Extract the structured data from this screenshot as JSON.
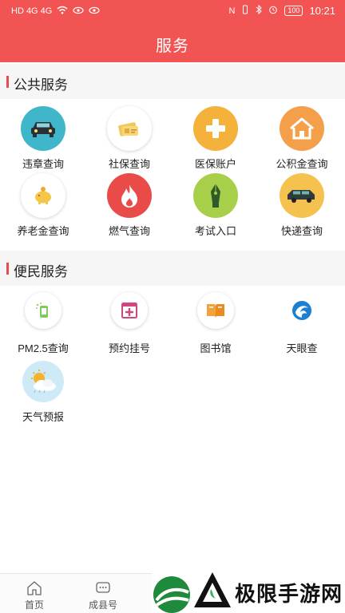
{
  "status_bar": {
    "left_text": "HD 4G 4G",
    "nfc": "N",
    "battery": "100",
    "time": "10:21"
  },
  "header": {
    "title": "服务"
  },
  "sections": {
    "public": {
      "title": "公共服务",
      "items": [
        {
          "label": "违章查询",
          "icon": "car-icon",
          "color": "#3fb6c9"
        },
        {
          "label": "社保查询",
          "icon": "id-card-icon",
          "color": "#ffffff"
        },
        {
          "label": "医保账户",
          "icon": "medical-cross-icon",
          "color": "#f5b23b"
        },
        {
          "label": "公积金查询",
          "icon": "house-icon",
          "color": "#f4a04a"
        },
        {
          "label": "养老金查询",
          "icon": "piggy-bank-icon",
          "color": "#ffffff"
        },
        {
          "label": "燃气查询",
          "icon": "flame-icon",
          "color": "#e84b48"
        },
        {
          "label": "考试入口",
          "icon": "pen-icon",
          "color": "#a7cf4a"
        },
        {
          "label": "快递查询",
          "icon": "delivery-car-icon",
          "color": "#f6c24f"
        }
      ]
    },
    "convenience": {
      "title": "便民服务",
      "items": [
        {
          "label": "PM2.5查询",
          "icon": "air-quality-icon",
          "color": "#ffffff"
        },
        {
          "label": "预约挂号",
          "icon": "appointment-icon",
          "color": "#ffffff"
        },
        {
          "label": "图书馆",
          "icon": "book-icon",
          "color": "#ffffff"
        },
        {
          "label": "天眼查",
          "icon": "sky-eye-icon",
          "color": "#ffffff"
        },
        {
          "label": "天气预报",
          "icon": "weather-icon",
          "color": "#cfeaf7"
        }
      ]
    }
  },
  "bottom_nav": {
    "home": "首页",
    "county": "成县号"
  },
  "watermark": {
    "text": "极限手游网"
  }
}
